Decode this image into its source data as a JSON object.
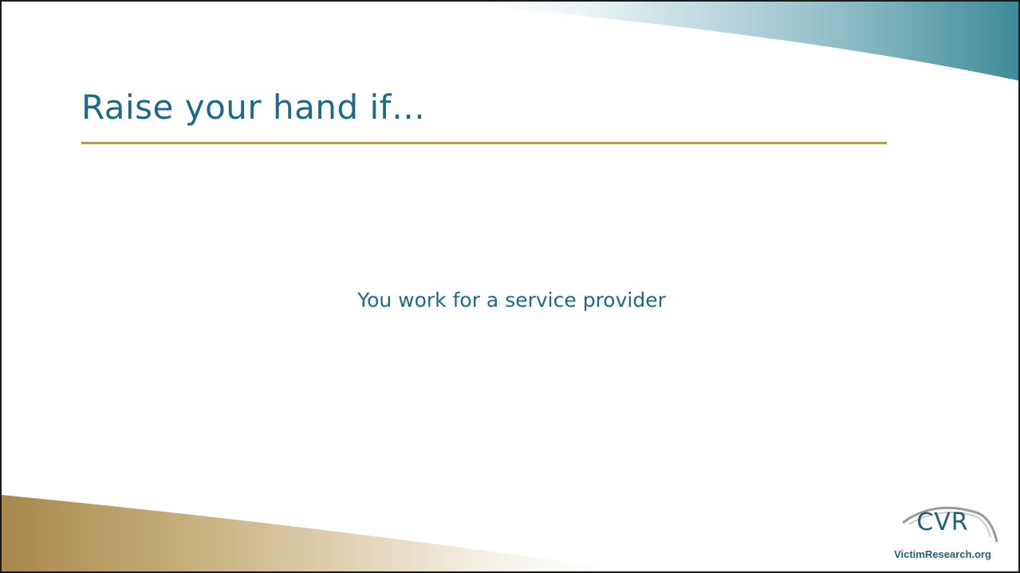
{
  "slide": {
    "title": "Raise your hand if…",
    "body": "You work for a service provider"
  },
  "logo": {
    "letters": "CVR",
    "url": "VictimResearch.org"
  },
  "colors": {
    "title": "#1d6a88",
    "rule": "#b09a5c",
    "teal_accent": "#3d8a98",
    "gold_accent": "#a8884a",
    "border": "#1a1a1a"
  }
}
